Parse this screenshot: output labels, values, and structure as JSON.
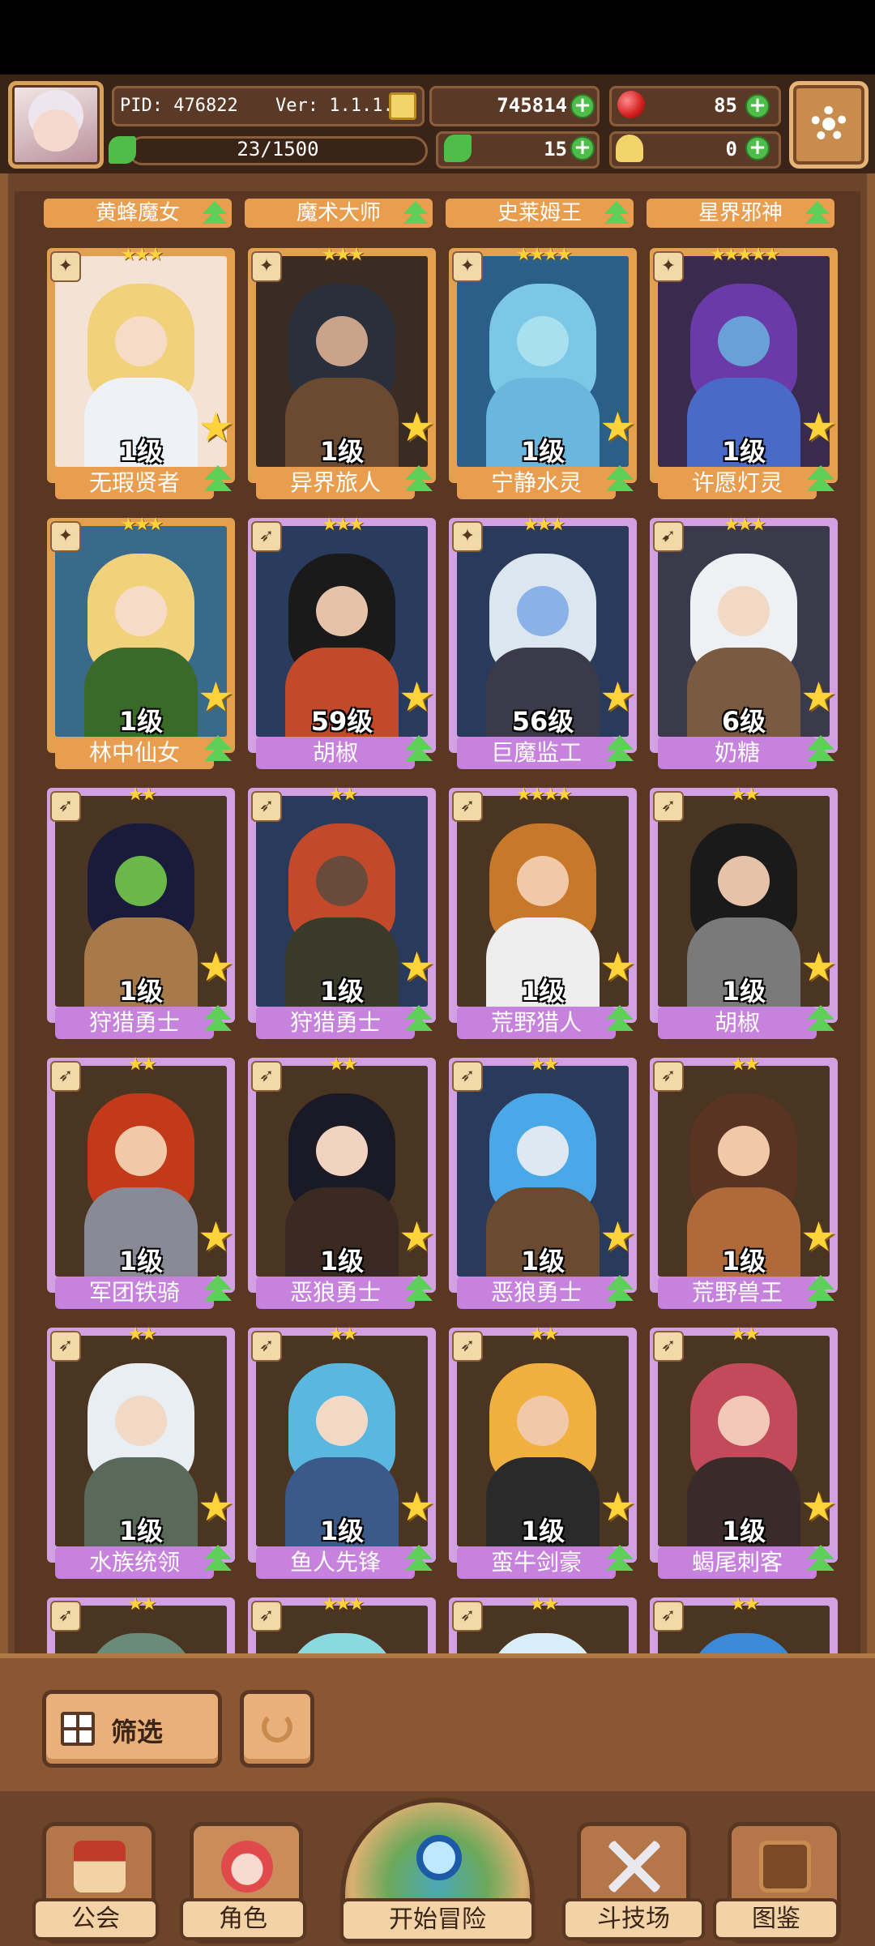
{
  "header": {
    "pid": "PID: 476822",
    "version": "Ver: 1.1.1.0",
    "gold": "745814",
    "gems": "85",
    "clover": "15",
    "keys": "0",
    "progress": "23/1500",
    "progress_value": 0.0153
  },
  "top_labels": [
    "黄蜂魔女",
    "魔术大师",
    "史莱姆王",
    "星界邪神"
  ],
  "cards": [
    {
      "name": "无瑕贤者",
      "level": "1级",
      "stars": 3,
      "rarity": "gold",
      "role": "✦",
      "palette": [
        "#f4e2d4",
        "#f1d27a",
        "#f6dcc6",
        "#eef2f6"
      ]
    },
    {
      "name": "异界旅人",
      "level": "1级",
      "stars": 3,
      "rarity": "gold",
      "role": "✦",
      "palette": [
        "#3a2c22",
        "#2a2f3c",
        "#c9a48a",
        "#6a4a30"
      ]
    },
    {
      "name": "宁静水灵",
      "level": "1级",
      "stars": 4,
      "rarity": "gold",
      "role": "✦",
      "palette": [
        "#2a5f8a",
        "#7cc7e6",
        "#a8e0f0",
        "#6ab6dc"
      ]
    },
    {
      "name": "许愿灯灵",
      "level": "1级",
      "stars": 5,
      "rarity": "gold",
      "role": "✦",
      "palette": [
        "#3a2a4e",
        "#6a3aa8",
        "#6aa0d8",
        "#4a6ac8"
      ]
    },
    {
      "name": "林中仙女",
      "level": "1级",
      "stars": 3,
      "rarity": "gold",
      "role": "✦",
      "palette": [
        "#3a6a8a",
        "#f1d27a",
        "#f6dcc6",
        "#3a6a2a"
      ]
    },
    {
      "name": "胡椒",
      "level": "59级",
      "stars": 3,
      "rarity": "purple",
      "role": "➶",
      "palette": [
        "#2a3c5e",
        "#1a1a1a",
        "#e6c2a8",
        "#c24a2a"
      ]
    },
    {
      "name": "巨魔监工",
      "level": "56级",
      "stars": 3,
      "rarity": "purple",
      "role": "✦",
      "palette": [
        "#2a3a5a",
        "#dce6ee",
        "#8ab2e8",
        "#3a3a4a"
      ]
    },
    {
      "name": "奶糖",
      "level": "6级",
      "stars": 3,
      "rarity": "purple",
      "role": "➹",
      "palette": [
        "#3a3a4a",
        "#eef0f4",
        "#f2d9c6",
        "#7a5a40"
      ]
    },
    {
      "name": "狩猎勇士",
      "level": "1级",
      "stars": 2,
      "rarity": "purple",
      "role": "➶",
      "palette": [
        "#4a3422",
        "#1a1a3a",
        "#6ab84a",
        "#a87a4a"
      ]
    },
    {
      "name": "狩猎勇士",
      "level": "1级",
      "stars": 2,
      "rarity": "purple",
      "role": "➶",
      "palette": [
        "#2a3a5a",
        "#c24a2a",
        "#6a4a3a",
        "#3a3a2a"
      ]
    },
    {
      "name": "荒野猎人",
      "level": "1级",
      "stars": 4,
      "rarity": "purple",
      "role": "➶",
      "palette": [
        "#4a3422",
        "#c8782a",
        "#f2c9a8",
        "#eeeeee"
      ]
    },
    {
      "name": "胡椒",
      "level": "1级",
      "stars": 2,
      "rarity": "purple",
      "role": "➶",
      "palette": [
        "#4a3422",
        "#1a1a1a",
        "#e6c2a8",
        "#7a7a7a"
      ]
    },
    {
      "name": "军团铁骑",
      "level": "1级",
      "stars": 2,
      "rarity": "purple",
      "role": "➶",
      "palette": [
        "#4a3422",
        "#c23a1a",
        "#f2c9a8",
        "#8a8a96"
      ]
    },
    {
      "name": "恶狼勇士",
      "level": "1级",
      "stars": 2,
      "rarity": "purple",
      "role": "➶",
      "palette": [
        "#4a3422",
        "#1a1a26",
        "#f2d2c0",
        "#3a2a22"
      ]
    },
    {
      "name": "恶狼勇士",
      "level": "1级",
      "stars": 2,
      "rarity": "purple",
      "role": "➶",
      "palette": [
        "#2a3a5a",
        "#4aa8e8",
        "#dde8f2",
        "#6a4a30"
      ]
    },
    {
      "name": "荒野兽王",
      "level": "1级",
      "stars": 2,
      "rarity": "purple",
      "role": "➶",
      "palette": [
        "#4a3422",
        "#5a3422",
        "#f2c9a8",
        "#b06a3a"
      ]
    },
    {
      "name": "水族统领",
      "level": "1级",
      "stars": 2,
      "rarity": "purple",
      "role": "➶",
      "palette": [
        "#4a3422",
        "#e8eef2",
        "#f2d9c6",
        "#5a6a5a"
      ]
    },
    {
      "name": "鱼人先锋",
      "level": "1级",
      "stars": 2,
      "rarity": "purple",
      "role": "➶",
      "palette": [
        "#4a3422",
        "#5ab8e0",
        "#f2d9c6",
        "#3a5a8a"
      ]
    },
    {
      "name": "蛮牛剑豪",
      "level": "1级",
      "stars": 2,
      "rarity": "purple",
      "role": "➶",
      "palette": [
        "#4a3422",
        "#f0b040",
        "#f2c9a8",
        "#2a2a2a"
      ]
    },
    {
      "name": "蝎尾刺客",
      "level": "1级",
      "stars": 2,
      "rarity": "purple",
      "role": "➶",
      "palette": [
        "#4a3422",
        "#c24a5a",
        "#f2c9b8",
        "#3a2a2a"
      ]
    }
  ],
  "partial_cards": [
    {
      "stars": 2,
      "role": "➶",
      "palette": [
        "#4a3422",
        "#6a8a7a"
      ]
    },
    {
      "stars": 3,
      "role": "➶",
      "palette": [
        "#4a3422",
        "#8ad8e0"
      ]
    },
    {
      "stars": 2,
      "role": "➶",
      "palette": [
        "#4a3422",
        "#d8eef8"
      ]
    },
    {
      "stars": 2,
      "role": "➶",
      "palette": [
        "#4a3422",
        "#3a8ad8"
      ]
    }
  ],
  "filter": {
    "label": "筛选"
  },
  "nav": {
    "guild": "公会",
    "character": "角色",
    "adventure": "开始冒险",
    "arena": "斗技场",
    "codex": "图鉴"
  }
}
